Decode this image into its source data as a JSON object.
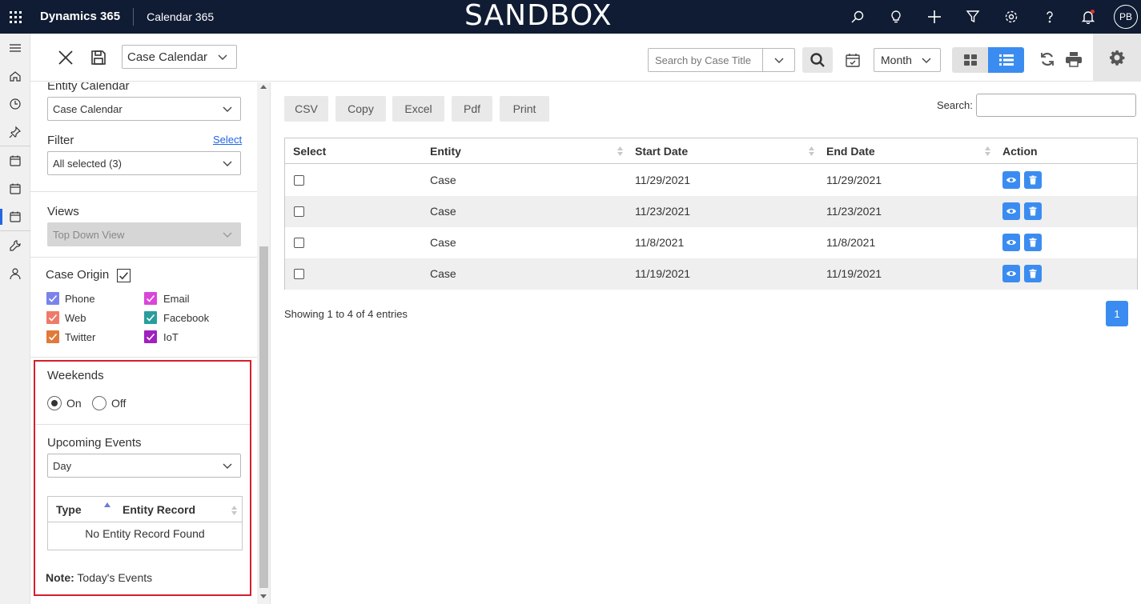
{
  "header": {
    "brand": "Dynamics 365",
    "app_name": "Calendar 365",
    "environment_label": "SANDBOX",
    "avatar_initials": "PB",
    "icons": [
      "search-icon",
      "lightbulb-icon",
      "plus-icon",
      "filter-icon",
      "settings-icon",
      "help-icon",
      "bell-icon"
    ]
  },
  "leftnav": {
    "icons": [
      "hamburger-icon",
      "home-icon",
      "recent-icon",
      "pin-icon",
      "calendar-icon",
      "calendar-icon",
      "calendar-icon",
      "tools-icon",
      "person-icon"
    ]
  },
  "commandbar": {
    "calendar_select": "Case Calendar",
    "search_placeholder": "Search by Case Title",
    "view_select": "Month"
  },
  "sidepanel": {
    "entity_calendar_title": "Entity Calendar",
    "entity_calendar_value": "Case Calendar",
    "filter_title": "Filter",
    "filter_link": "Select",
    "filter_value": "All selected (3)",
    "views_title": "Views",
    "views_value": "Top Down View",
    "case_origin_title": "Case Origin",
    "origins": [
      {
        "label": "Phone",
        "color": "#7b83eb"
      },
      {
        "label": "Email",
        "color": "#d946d9"
      },
      {
        "label": "Web",
        "color": "#f07a6a"
      },
      {
        "label": "Facebook",
        "color": "#2a9d9d"
      },
      {
        "label": "Twitter",
        "color": "#e07a3a"
      },
      {
        "label": "IoT",
        "color": "#a020c0"
      }
    ],
    "weekends_title": "Weekends",
    "weekends_on": "On",
    "weekends_off": "Off",
    "upcoming_title": "Upcoming Events",
    "upcoming_value": "Day",
    "upcoming_table": {
      "headers": [
        "Type",
        "Entity Record"
      ],
      "empty_text": "No Entity Record Found"
    },
    "note_label": "Note:",
    "note_text": "Today's Events"
  },
  "main": {
    "export_buttons": [
      "CSV",
      "Copy",
      "Excel",
      "Pdf",
      "Print"
    ],
    "search_label": "Search:",
    "table": {
      "headers": [
        "Select",
        "Entity",
        "Start Date",
        "End Date",
        "Action"
      ],
      "rows": [
        {
          "entity": "Case",
          "start": "11/29/2021",
          "end": "11/29/2021"
        },
        {
          "entity": "Case",
          "start": "11/23/2021",
          "end": "11/23/2021"
        },
        {
          "entity": "Case",
          "start": "11/8/2021",
          "end": "11/8/2021"
        },
        {
          "entity": "Case",
          "start": "11/19/2021",
          "end": "11/19/2021"
        }
      ]
    },
    "showing_text": "Showing 1 to 4 of 4 entries",
    "current_page": "1"
  },
  "colors": {
    "topbar": "#0f1c33",
    "accent": "#3b8cf0",
    "highlight_border": "#d4202b"
  }
}
